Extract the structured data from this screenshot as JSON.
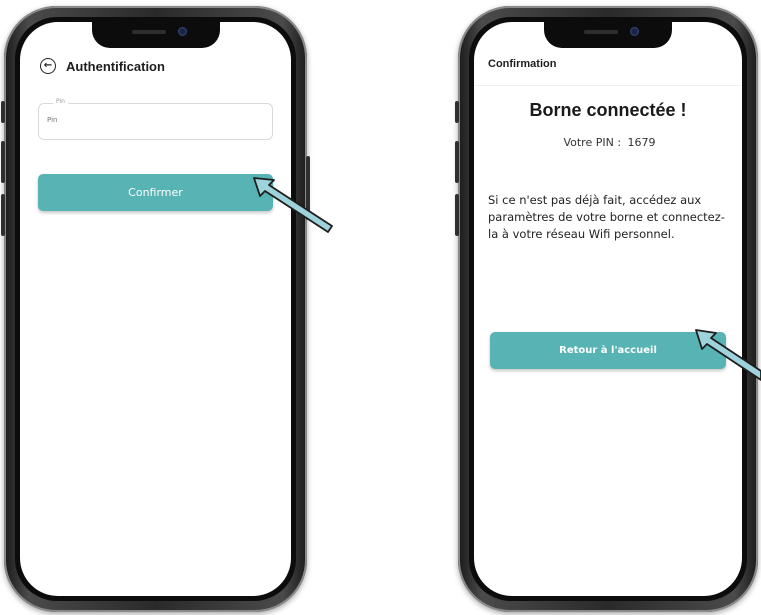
{
  "colors": {
    "accent": "#58b3b4",
    "arrow_fill": "#9fd3dc",
    "arrow_stroke": "#1e1e1e"
  },
  "auth_screen": {
    "back_icon": "back-arrow-circle-icon",
    "title": "Authentification",
    "pin_field": {
      "label": "Pin",
      "placeholder": "Pin",
      "value": ""
    },
    "confirm_label": "Confirmer"
  },
  "confirm_screen": {
    "header": "Confirmation",
    "success_title": "Borne connectée !",
    "pin_label": "Votre PIN :",
    "pin_value": "1679",
    "info_text": "Si ce n'est pas déjà fait, accédez aux paramètres de votre borne et connectez-la à votre réseau Wifi personnel.",
    "home_label": "Retour à l'accueil"
  }
}
